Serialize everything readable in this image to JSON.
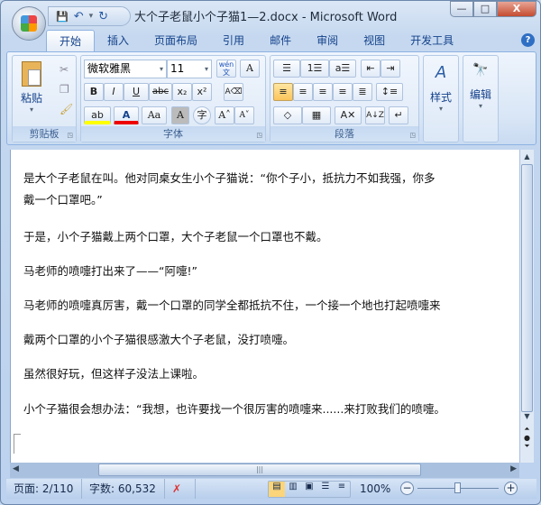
{
  "window": {
    "title": "大个子老鼠小个子猫1—2.docx - Microsoft Word",
    "min": "—",
    "max": "□",
    "close": "X"
  },
  "qat": {
    "save": "💾",
    "undo": "↶",
    "undo_dd": "▾",
    "redo": "↻",
    "customize": "▾"
  },
  "tabs": [
    "开始",
    "插入",
    "页面布局",
    "引用",
    "邮件",
    "审阅",
    "视图",
    "开发工具"
  ],
  "help": "?",
  "ribbon": {
    "clipboard": {
      "label": "剪贴板",
      "paste": "粘贴"
    },
    "font": {
      "label": "字体",
      "font_name": "微软雅黑",
      "font_size": "11",
      "bold": "B",
      "italic": "I",
      "underline": "U",
      "strike": "abc",
      "sub": "x₂",
      "sup": "x²",
      "change_case": "Aa",
      "grow": "A˄",
      "shrink": "A˅",
      "phonetic": "wén文",
      "border": "A",
      "shading": "A",
      "enclose": "字",
      "highlight": "ab",
      "color": "A",
      "clear": "A⌫"
    },
    "paragraph": {
      "label": "段落",
      "bullets": "☰",
      "numbering": "1☰",
      "multilevel": "a☰",
      "dec_indent": "⇤",
      "inc_indent": "⇥",
      "align_left": "≡",
      "center": "≡",
      "align_right": "≡",
      "justify": "≡",
      "distribute": "≣",
      "spacing": "↕≡",
      "shading": "◇",
      "borders": "▦",
      "asian": "A✕",
      "sort": "A↓Z",
      "marks": "↵"
    },
    "styles": {
      "label": "样式",
      "icon": "A"
    },
    "editing": {
      "label": "编辑",
      "icon": "🔭"
    }
  },
  "document": {
    "paragraphs": [
      "是大个子老鼠在叫。他对同桌女生小个子猫说：“你个子小，抵抗力不如我强，你多",
      "戴一个口罩吧。”",
      "于是，小个子猫戴上两个口罩，大个子老鼠一个口罩也不戴。",
      "马老师的喷嚏打出来了——“阿嚏!”",
      "马老师的喷嚏真厉害，戴一个口罩的同学全都抵抗不住，一个接一个地也打起喷嚏来",
      "戴两个口罩的小个子猫很感激大个子老鼠，没打喷嚏。",
      "虽然很好玩，但这样子没法上课啦。",
      "小个子猫很会想办法：“我想，也许要找一个很厉害的喷嚏来......来打败我们的喷嚏。"
    ]
  },
  "status": {
    "page": "页面: 2/110",
    "words": "字数: 60,532",
    "zoom": "100%",
    "zoom_level": 100
  },
  "colors": {
    "accent": "#15428b",
    "highlight": "#ffff00",
    "font_color": "#e00000"
  }
}
